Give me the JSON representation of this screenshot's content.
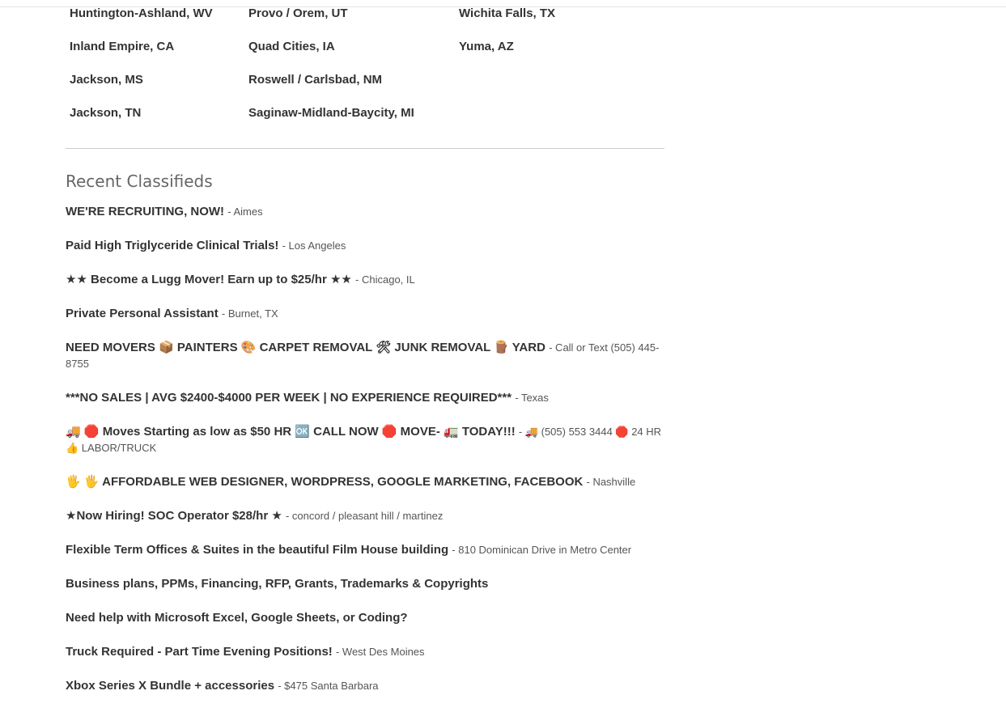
{
  "cities": {
    "col1": [
      "Huntington-Ashland, WV",
      "Inland Empire, CA",
      "Jackson, MS",
      "Jackson, TN"
    ],
    "col2": [
      "Provo / Orem, UT",
      "Quad Cities, IA",
      "Roswell / Carlsbad, NM",
      "Saginaw-Midland-Baycity, MI"
    ],
    "col3": [
      "Wichita Falls, TX",
      "Yuma, AZ"
    ]
  },
  "section_title": "Recent Classifieds",
  "listings": [
    {
      "title": "WE'RE RECRUITING, NOW!",
      "location": "- Aimes"
    },
    {
      "title": "Paid High Triglyceride Clinical Trials!",
      "location": "- Los Angeles"
    },
    {
      "title": "★★ Become a Lugg Mover! Earn up to $25/hr ★★",
      "location": "- Chicago, IL"
    },
    {
      "title": "Private Personal Assistant",
      "location": "- Burnet, TX"
    },
    {
      "title": "NEED MOVERS 📦 PAINTERS 🎨 CARPET REMOVAL 🛠 JUNK REMOVAL 🪵 YARD",
      "location": "- Call or Text (505) 445-8755"
    },
    {
      "title": "***NO SALES | AVG $2400-$4000 PER WEEK | NO EXPERIENCE REQUIRED***",
      "location": "- Texas"
    },
    {
      "title": "🚚 🛑 Moves Starting as low as $50 HR 🆗 CALL NOW 🛑 MOVE- 🚛 TODAY!!!",
      "location": "- 🚚 (505) 553 3444 🛑 24 HR 👍 LABOR/TRUCK"
    },
    {
      "title": "🖐 🖐 AFFORDABLE WEB DESIGNER, WORDPRESS, GOOGLE MARKETING, FACEBOOK",
      "location": "- Nashville"
    },
    {
      "title": "★Now Hiring! SOC Operator $28/hr ★",
      "location": "- concord / pleasant hill / martinez"
    },
    {
      "title": "Flexible Term Offices & Suites in the beautiful Film House building",
      "location": "- 810 Dominican Drive in Metro Center"
    },
    {
      "title": "Business plans, PPMs, Financing, RFP, Grants, Trademarks & Copyrights",
      "location": ""
    },
    {
      "title": "Need help with Microsoft Excel, Google Sheets, or Coding?",
      "location": ""
    },
    {
      "title": "Truck Required - Part Time Evening Positions!",
      "location": "- West Des Moines"
    },
    {
      "title": "Xbox Series X Bundle + accessories",
      "location": "- $475 Santa Barbara"
    }
  ]
}
